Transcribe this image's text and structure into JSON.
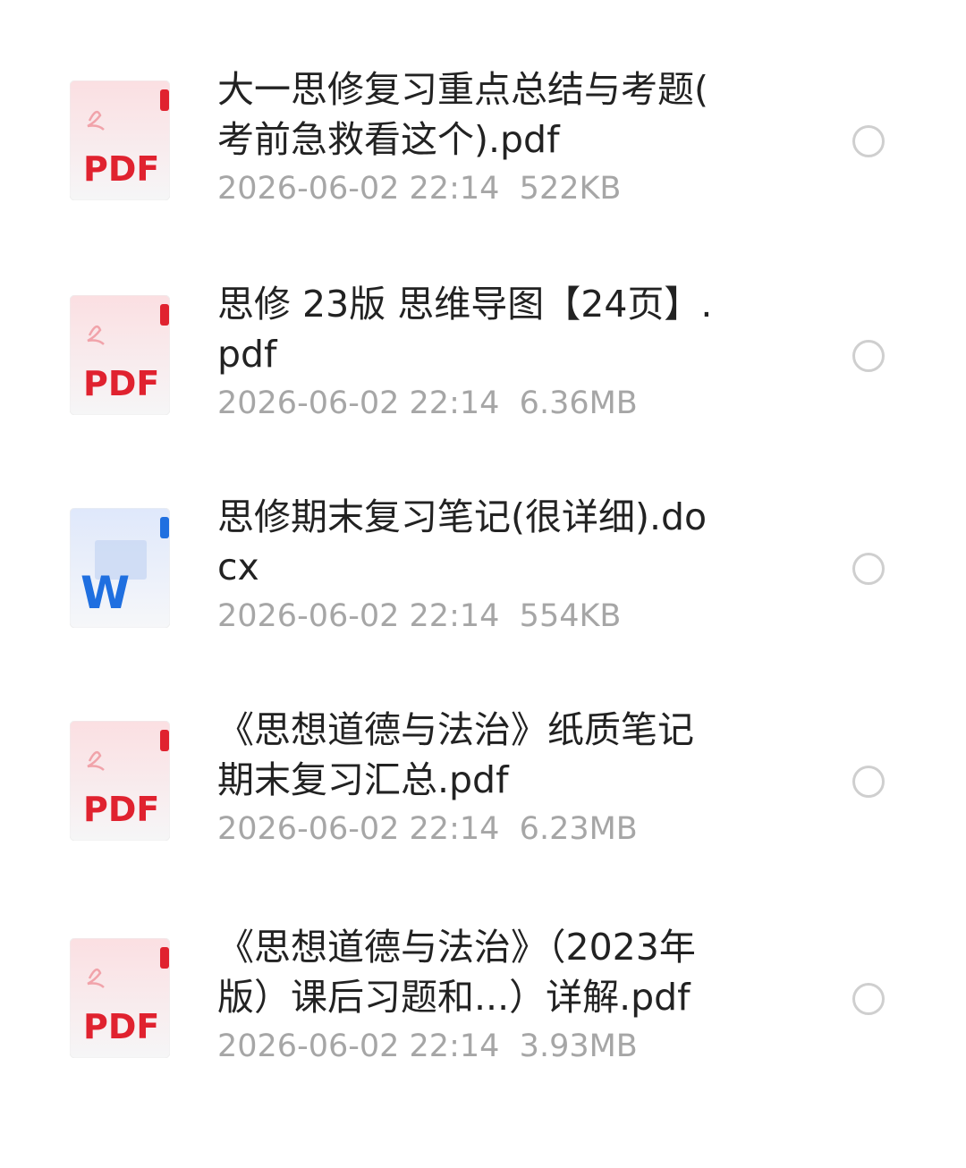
{
  "files": [
    {
      "type": "pdf",
      "icon_label": "PDF",
      "name_line1": "大一思修复习重点总结与考题(",
      "name_line2": "考前急救看这个).pdf",
      "date": "2026-06-02 22:14",
      "size": "522KB"
    },
    {
      "type": "pdf",
      "icon_label": "PDF",
      "name_line1": "思修 23版 思维导图【24页】.",
      "name_line2": "pdf",
      "date": "2026-06-02 22:14",
      "size": "6.36MB"
    },
    {
      "type": "docx",
      "icon_label": "W",
      "name_line1": "思修期末复习笔记(很详细).do",
      "name_line2": "cx",
      "date": "2026-06-02 22:14",
      "size": "554KB"
    },
    {
      "type": "pdf",
      "icon_label": "PDF",
      "name_line1": "《思想道德与法治》纸质笔记",
      "name_line2": "期末复习汇总.pdf",
      "date": "2026-06-02 22:14",
      "size": "6.23MB"
    },
    {
      "type": "pdf",
      "icon_label": "PDF",
      "name_line1": "《思想道德与法治》（2023年",
      "name_line2": "版）课后习题和...）详解.pdf",
      "date": "2026-06-02 22:14",
      "size": "3.93MB"
    }
  ],
  "colors": {
    "pdf_accent": "#e0222f",
    "pdf_icon_bg": "#fbe6e8",
    "word_accent": "#1f6fe0",
    "word_icon_bg": "#e6eefb",
    "name_text": "#222222",
    "meta_text": "#a6a6a6",
    "radio_border": "#cfcfcf"
  },
  "icons": {
    "pdf": "pdf-file-icon",
    "docx": "word-file-icon",
    "select": "radio-circle"
  }
}
